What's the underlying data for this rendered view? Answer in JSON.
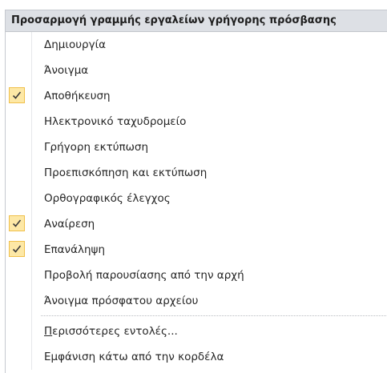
{
  "menu": {
    "header": "Προσαρμογή γραμμής εργαλείων γρήγορης πρόσβασης",
    "items": [
      {
        "label": "Δημιουργία",
        "checked": false
      },
      {
        "label": "Άνοιγμα",
        "checked": false
      },
      {
        "label": "Αποθήκευση",
        "checked": true
      },
      {
        "label": "Ηλεκτρονικό ταχυδρομείο",
        "checked": false
      },
      {
        "label": "Γρήγορη εκτύπωση",
        "checked": false
      },
      {
        "label": "Προεπισκόπηση και εκτύπωση",
        "checked": false
      },
      {
        "label": "Ορθογραφικός έλεγχος",
        "checked": false
      },
      {
        "label": "Αναίρεση",
        "checked": true
      },
      {
        "label": "Επανάληψη",
        "checked": true
      },
      {
        "label": "Προβολή παρουσίασης από την αρχή",
        "checked": false
      },
      {
        "label": "Άνοιγμα πρόσφατου αρχείου",
        "checked": false
      }
    ],
    "more_commands_label": "Περισσότερες εντολές...",
    "more_commands_mnemonic": "Π",
    "more_commands_rest": "ερισσότερες εντολές...",
    "show_below_label": "Εμφάνιση κάτω από την κορδέλα"
  },
  "icons": {
    "check": "checkmark-icon"
  },
  "colors": {
    "header_bg": "#dde0e5",
    "check_bg": "#fde8a6",
    "check_border": "#f0c04a",
    "check_mark": "#3b3b3b"
  }
}
